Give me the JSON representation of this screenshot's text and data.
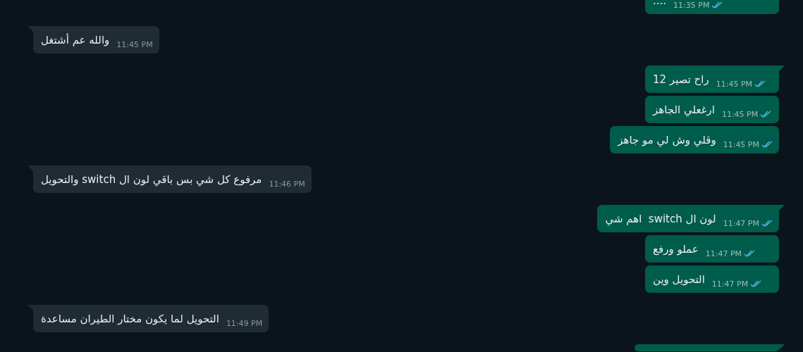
{
  "messages": [
    {
      "kind": "outgoing",
      "text": "....",
      "time": "11:35 PM",
      "read": true
    },
    {
      "kind": "incoming",
      "text": "والله عم أشتغل",
      "time": "11:45 PM"
    },
    {
      "kind": "outgoing",
      "text": "راح تصير 12",
      "time": "11:45 PM",
      "read": true
    },
    {
      "kind": "outgoing",
      "text": "ارغعلي الجاهز",
      "time": "11:45 PM",
      "read": true
    },
    {
      "kind": "outgoing",
      "text": "وقلي وش لي مو جاهز",
      "time": "11:45 PM",
      "read": true
    },
    {
      "kind": "incoming",
      "text": "مرفوع كل شي بس باقي لون ال switch والتحويل",
      "time": "11:46 PM"
    },
    {
      "kind": "outgoing",
      "text": "لون ال switch  اهم شي",
      "time": "11:47 PM",
      "read": true
    },
    {
      "kind": "outgoing",
      "text": "عملو ورفع",
      "time": "11:47 PM",
      "read": true
    },
    {
      "kind": "outgoing",
      "text": "التحويل وين",
      "time": "11:47 PM",
      "read": true
    },
    {
      "kind": "incoming",
      "text": "التحويل لما يكون مختار الطيران مساعدة",
      "time": "11:49 PM"
    },
    {
      "kind": "outgoing"
    }
  ]
}
